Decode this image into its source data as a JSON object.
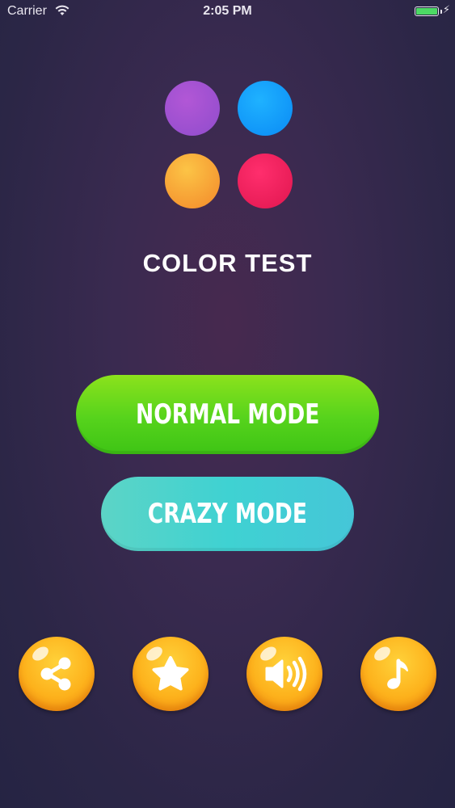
{
  "status_bar": {
    "carrier": "Carrier",
    "time": "2:05 PM",
    "battery_level": 1.0,
    "charging_icon": "bolt-icon"
  },
  "logo": {
    "dots": [
      {
        "name": "purple",
        "color": "#a052d2"
      },
      {
        "name": "blue",
        "color": "#1aa0fb"
      },
      {
        "name": "orange",
        "color": "#f7a536"
      },
      {
        "name": "red",
        "color": "#ef1f5c"
      }
    ]
  },
  "title": "COLOR TEST",
  "buttons": {
    "normal_mode": "NORMAL MODE",
    "crazy_mode": "CRAZY MODE"
  },
  "bottom_bar": {
    "icons": [
      "share-icon",
      "star-icon",
      "sound-icon",
      "music-note-icon"
    ]
  },
  "colors": {
    "normal_mode": "#56d31c",
    "crazy_mode": "#3fd2d2",
    "round_button": "#fdb21c"
  }
}
